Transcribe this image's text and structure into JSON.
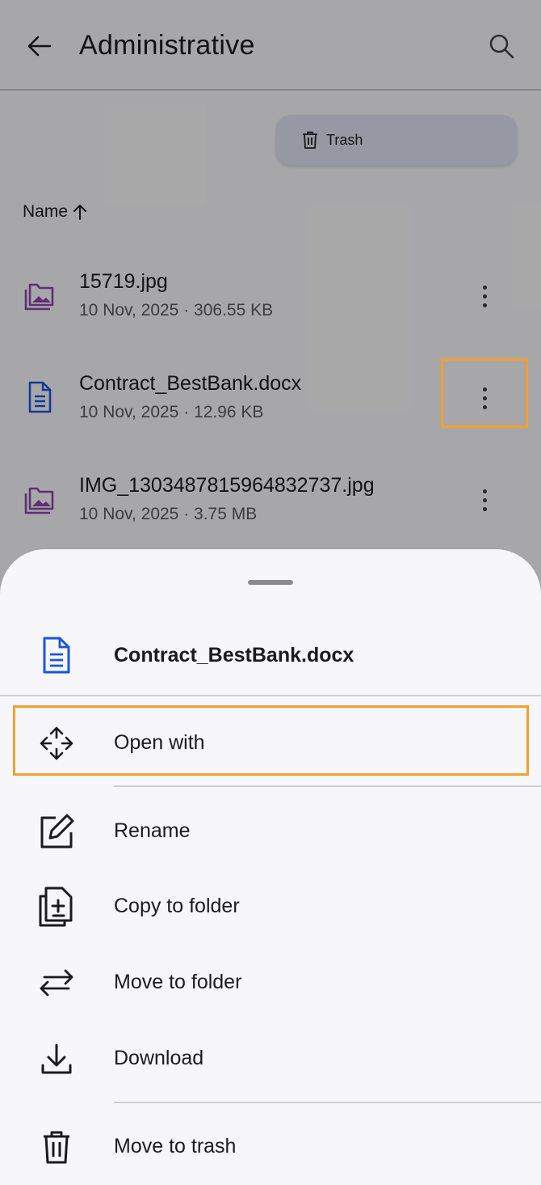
{
  "appbar": {
    "title": "Administrative",
    "back_icon": "arrow-back-icon",
    "search_icon": "search-icon"
  },
  "trash_chip": {
    "label": "Trash",
    "icon": "trash-icon"
  },
  "sort": {
    "label": "Name",
    "icon": "arrow-up-icon"
  },
  "files": [
    {
      "name": "15719.jpg",
      "meta": "10 Nov, 2025 · 306.55 KB",
      "icon": "image-folder-icon",
      "icon_color": "#8e44ad"
    },
    {
      "name": "Contract_BestBank.docx",
      "meta": "10 Nov, 2025 · 12.96 KB",
      "icon": "document-icon",
      "icon_color": "#1a56db"
    },
    {
      "name": "IMG_1303487815964832737.jpg",
      "meta": "10 Nov, 2025 · 3.75 MB",
      "icon": "image-folder-icon",
      "icon_color": "#8e44ad"
    }
  ],
  "sheet": {
    "file_name": "Contract_BestBank.docx",
    "menu": [
      {
        "label": "Open with",
        "icon": "move-arrows-icon"
      },
      {
        "label": "Rename",
        "icon": "edit-icon"
      },
      {
        "label": "Copy to folder",
        "icon": "copy-icon"
      },
      {
        "label": "Move to folder",
        "icon": "swap-arrows-icon"
      },
      {
        "label": "Download",
        "icon": "download-icon"
      },
      {
        "label": "Move to trash",
        "icon": "trash-icon"
      }
    ]
  },
  "colors": {
    "highlight": "#f3a030",
    "doc_blue": "#1a56db",
    "image_purple": "#8e44ad",
    "chip_bg": "#dde2f2"
  }
}
